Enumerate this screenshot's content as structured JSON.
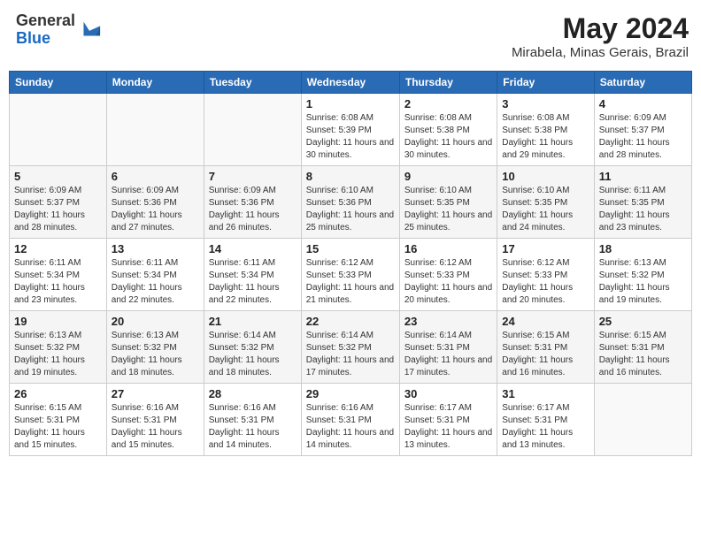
{
  "logo": {
    "general": "General",
    "blue": "Blue"
  },
  "title": "May 2024",
  "subtitle": "Mirabela, Minas Gerais, Brazil",
  "days_of_week": [
    "Sunday",
    "Monday",
    "Tuesday",
    "Wednesday",
    "Thursday",
    "Friday",
    "Saturday"
  ],
  "weeks": [
    [
      {
        "day": "",
        "sunrise": "",
        "sunset": "",
        "daylight": ""
      },
      {
        "day": "",
        "sunrise": "",
        "sunset": "",
        "daylight": ""
      },
      {
        "day": "",
        "sunrise": "",
        "sunset": "",
        "daylight": ""
      },
      {
        "day": "1",
        "sunrise": "6:08 AM",
        "sunset": "5:39 PM",
        "daylight": "11 hours and 30 minutes."
      },
      {
        "day": "2",
        "sunrise": "6:08 AM",
        "sunset": "5:38 PM",
        "daylight": "11 hours and 30 minutes."
      },
      {
        "day": "3",
        "sunrise": "6:08 AM",
        "sunset": "5:38 PM",
        "daylight": "11 hours and 29 minutes."
      },
      {
        "day": "4",
        "sunrise": "6:09 AM",
        "sunset": "5:37 PM",
        "daylight": "11 hours and 28 minutes."
      }
    ],
    [
      {
        "day": "5",
        "sunrise": "6:09 AM",
        "sunset": "5:37 PM",
        "daylight": "11 hours and 28 minutes."
      },
      {
        "day": "6",
        "sunrise": "6:09 AM",
        "sunset": "5:36 PM",
        "daylight": "11 hours and 27 minutes."
      },
      {
        "day": "7",
        "sunrise": "6:09 AM",
        "sunset": "5:36 PM",
        "daylight": "11 hours and 26 minutes."
      },
      {
        "day": "8",
        "sunrise": "6:10 AM",
        "sunset": "5:36 PM",
        "daylight": "11 hours and 25 minutes."
      },
      {
        "day": "9",
        "sunrise": "6:10 AM",
        "sunset": "5:35 PM",
        "daylight": "11 hours and 25 minutes."
      },
      {
        "day": "10",
        "sunrise": "6:10 AM",
        "sunset": "5:35 PM",
        "daylight": "11 hours and 24 minutes."
      },
      {
        "day": "11",
        "sunrise": "6:11 AM",
        "sunset": "5:35 PM",
        "daylight": "11 hours and 23 minutes."
      }
    ],
    [
      {
        "day": "12",
        "sunrise": "6:11 AM",
        "sunset": "5:34 PM",
        "daylight": "11 hours and 23 minutes."
      },
      {
        "day": "13",
        "sunrise": "6:11 AM",
        "sunset": "5:34 PM",
        "daylight": "11 hours and 22 minutes."
      },
      {
        "day": "14",
        "sunrise": "6:11 AM",
        "sunset": "5:34 PM",
        "daylight": "11 hours and 22 minutes."
      },
      {
        "day": "15",
        "sunrise": "6:12 AM",
        "sunset": "5:33 PM",
        "daylight": "11 hours and 21 minutes."
      },
      {
        "day": "16",
        "sunrise": "6:12 AM",
        "sunset": "5:33 PM",
        "daylight": "11 hours and 20 minutes."
      },
      {
        "day": "17",
        "sunrise": "6:12 AM",
        "sunset": "5:33 PM",
        "daylight": "11 hours and 20 minutes."
      },
      {
        "day": "18",
        "sunrise": "6:13 AM",
        "sunset": "5:32 PM",
        "daylight": "11 hours and 19 minutes."
      }
    ],
    [
      {
        "day": "19",
        "sunrise": "6:13 AM",
        "sunset": "5:32 PM",
        "daylight": "11 hours and 19 minutes."
      },
      {
        "day": "20",
        "sunrise": "6:13 AM",
        "sunset": "5:32 PM",
        "daylight": "11 hours and 18 minutes."
      },
      {
        "day": "21",
        "sunrise": "6:14 AM",
        "sunset": "5:32 PM",
        "daylight": "11 hours and 18 minutes."
      },
      {
        "day": "22",
        "sunrise": "6:14 AM",
        "sunset": "5:32 PM",
        "daylight": "11 hours and 17 minutes."
      },
      {
        "day": "23",
        "sunrise": "6:14 AM",
        "sunset": "5:31 PM",
        "daylight": "11 hours and 17 minutes."
      },
      {
        "day": "24",
        "sunrise": "6:15 AM",
        "sunset": "5:31 PM",
        "daylight": "11 hours and 16 minutes."
      },
      {
        "day": "25",
        "sunrise": "6:15 AM",
        "sunset": "5:31 PM",
        "daylight": "11 hours and 16 minutes."
      }
    ],
    [
      {
        "day": "26",
        "sunrise": "6:15 AM",
        "sunset": "5:31 PM",
        "daylight": "11 hours and 15 minutes."
      },
      {
        "day": "27",
        "sunrise": "6:16 AM",
        "sunset": "5:31 PM",
        "daylight": "11 hours and 15 minutes."
      },
      {
        "day": "28",
        "sunrise": "6:16 AM",
        "sunset": "5:31 PM",
        "daylight": "11 hours and 14 minutes."
      },
      {
        "day": "29",
        "sunrise": "6:16 AM",
        "sunset": "5:31 PM",
        "daylight": "11 hours and 14 minutes."
      },
      {
        "day": "30",
        "sunrise": "6:17 AM",
        "sunset": "5:31 PM",
        "daylight": "11 hours and 13 minutes."
      },
      {
        "day": "31",
        "sunrise": "6:17 AM",
        "sunset": "5:31 PM",
        "daylight": "11 hours and 13 minutes."
      },
      {
        "day": "",
        "sunrise": "",
        "sunset": "",
        "daylight": ""
      }
    ]
  ]
}
